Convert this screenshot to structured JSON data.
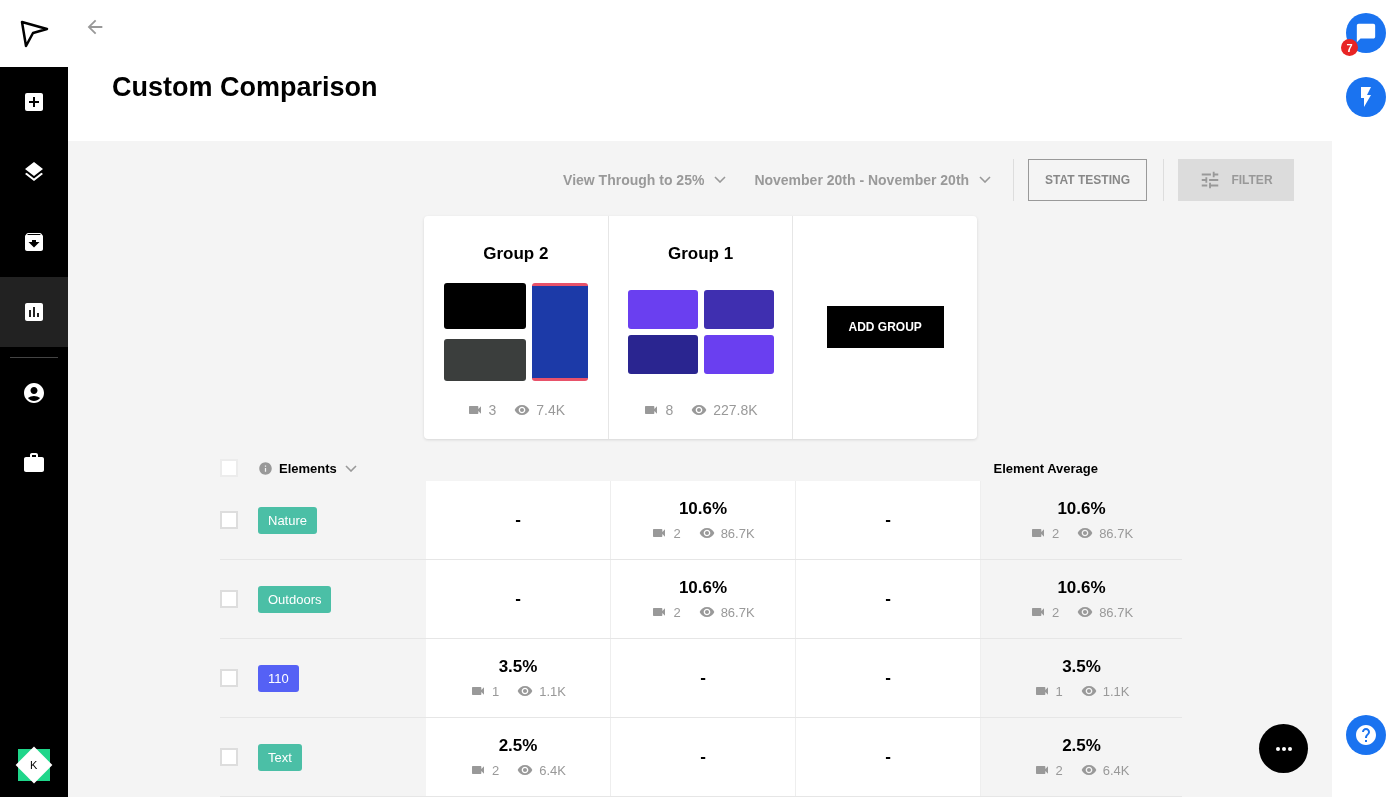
{
  "sidebar": {
    "items": [
      {
        "selected": false
      },
      {
        "selected": false
      },
      {
        "selected": false
      },
      {
        "selected": true
      },
      {
        "selected": false
      },
      {
        "selected": false
      }
    ],
    "avatar": "K"
  },
  "page": {
    "title": "Custom Comparison"
  },
  "toolbar": {
    "metric": "View Through to 25%",
    "date_range": "November 20th - November 20th",
    "stat_testing": "STAT TESTING",
    "filter": {
      "label": "FILTER",
      "disabled": true
    }
  },
  "groups": [
    {
      "name": "Group 2",
      "videos": "3",
      "views": "7.4K"
    },
    {
      "name": "Group 1",
      "videos": "8",
      "views": "227.8K"
    }
  ],
  "add_group": "ADD GROUP",
  "table": {
    "header": {
      "label": "Elements",
      "checked": false
    },
    "average_label": "Element Average",
    "rows": [
      {
        "tag": "Nature",
        "color": "#4bbfa6",
        "checked": false,
        "cells": [
          {
            "kind": "empty",
            "value": "-"
          },
          {
            "kind": "stat",
            "value": "10.6%",
            "videos": "2",
            "views": "86.7K"
          },
          {
            "kind": "empty",
            "value": "-"
          }
        ],
        "average": {
          "value": "10.6%",
          "videos": "2",
          "views": "86.7K"
        }
      },
      {
        "tag": "Outdoors",
        "color": "#4bbfa6",
        "checked": false,
        "cells": [
          {
            "kind": "empty",
            "value": "-"
          },
          {
            "kind": "stat",
            "value": "10.6%",
            "videos": "2",
            "views": "86.7K"
          },
          {
            "kind": "empty",
            "value": "-"
          }
        ],
        "average": {
          "value": "10.6%",
          "videos": "2",
          "views": "86.7K"
        }
      },
      {
        "tag": "110",
        "color": "#5561f5",
        "checked": false,
        "cells": [
          {
            "kind": "stat",
            "value": "3.5%",
            "videos": "1",
            "views": "1.1K"
          },
          {
            "kind": "empty",
            "value": "-"
          },
          {
            "kind": "empty",
            "value": "-"
          }
        ],
        "average": {
          "value": "3.5%",
          "videos": "1",
          "views": "1.1K"
        }
      },
      {
        "tag": "Text",
        "color": "#4bbfa6",
        "checked": false,
        "cells": [
          {
            "kind": "stat",
            "value": "2.5%",
            "videos": "2",
            "views": "6.4K"
          },
          {
            "kind": "empty",
            "value": "-"
          },
          {
            "kind": "empty",
            "value": "-"
          }
        ],
        "average": {
          "value": "2.5%",
          "videos": "2",
          "views": "6.4K"
        }
      }
    ]
  },
  "notifications": {
    "count": "7"
  }
}
